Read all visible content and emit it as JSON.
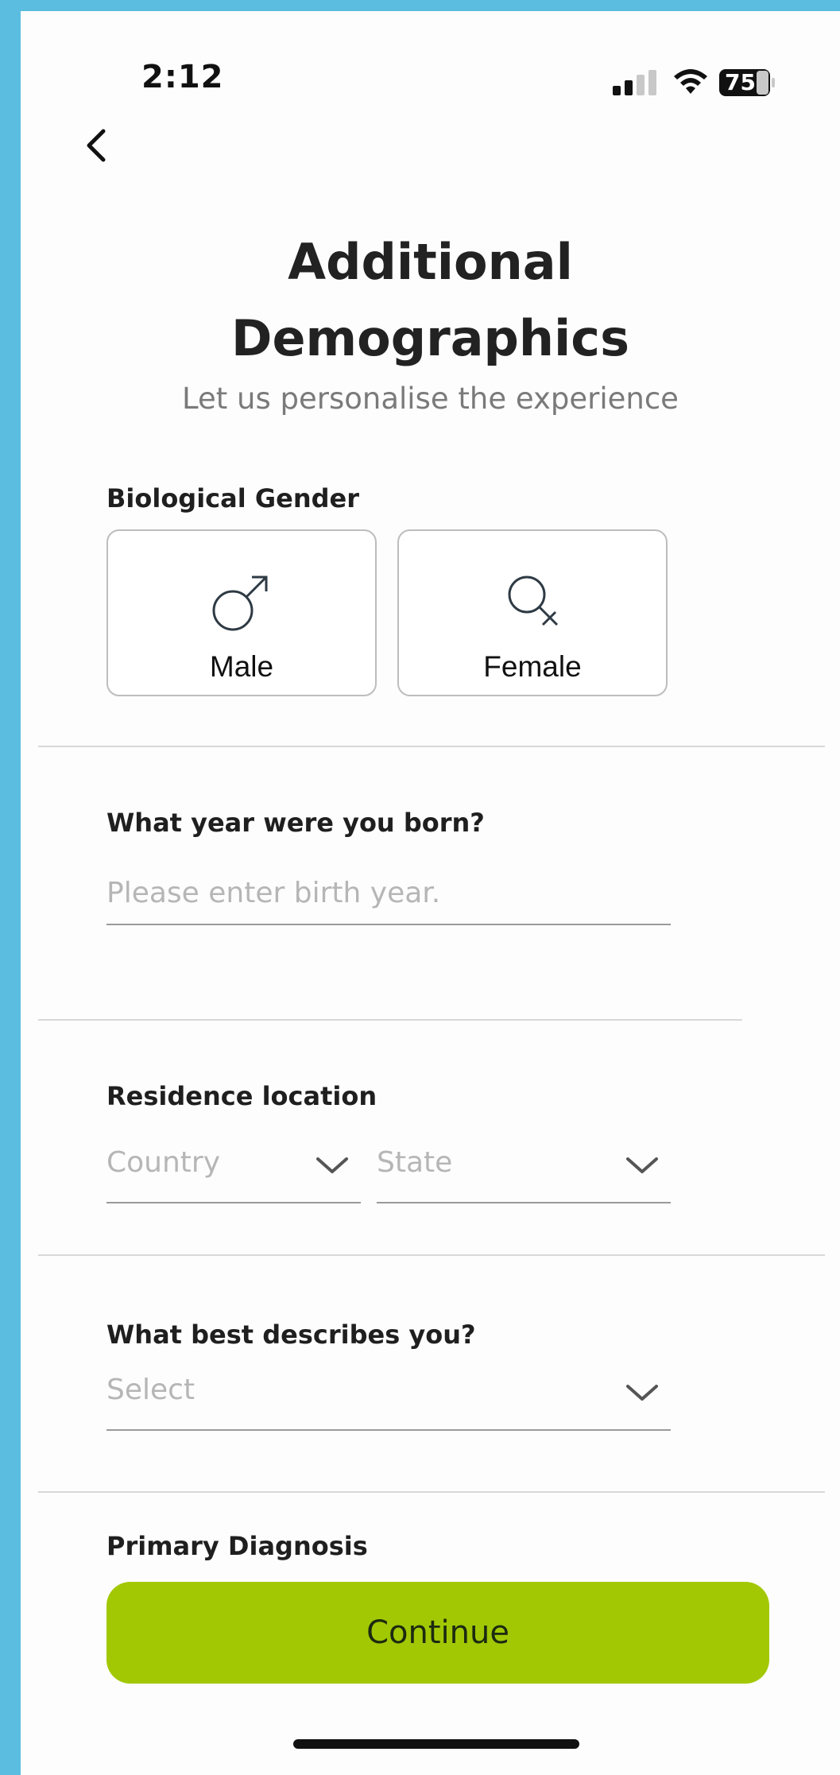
{
  "status_bar": {
    "time": "2:12",
    "battery": "75",
    "icons": [
      "cellular-signal-icon",
      "wifi-icon",
      "battery-icon"
    ]
  },
  "header": {
    "back_icon": "chevron-left-icon",
    "title_line1": "Additional",
    "title_line2": "Demographics",
    "subtitle": "Let us personalise the experience"
  },
  "gender": {
    "label": "Biological Gender",
    "options": [
      {
        "label": "Male",
        "icon": "male-symbol-icon"
      },
      {
        "label": "Female",
        "icon": "female-symbol-icon"
      }
    ]
  },
  "birth_year": {
    "label": "What year were you born?",
    "placeholder": "Please enter birth year.",
    "value": ""
  },
  "residence": {
    "label": "Residence location",
    "country_placeholder": "Country",
    "state_placeholder": "State"
  },
  "describes": {
    "label": "What best describes you?",
    "placeholder": "Select"
  },
  "diagnosis": {
    "label": "Primary Diagnosis"
  },
  "continue_label": "Continue",
  "colors": {
    "accent": "#a2c804",
    "background": "#5bbde0"
  }
}
